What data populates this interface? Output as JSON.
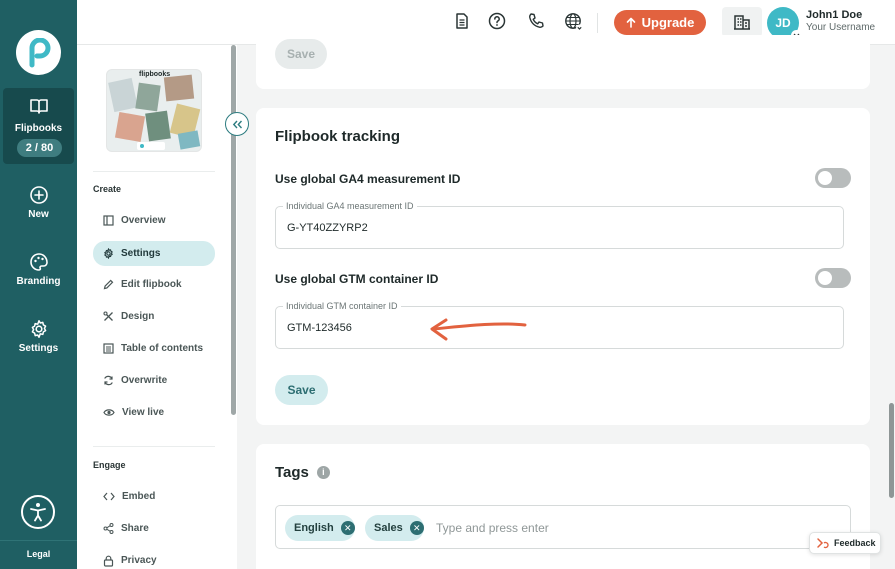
{
  "rail": {
    "flipbooks_label": "Flipbooks",
    "flipbooks_count": "2 / 80",
    "new_label": "New",
    "branding_label": "Branding",
    "settings_label": "Settings",
    "legal_label": "Legal"
  },
  "topbar": {
    "upgrade_label": "Upgrade",
    "avatar_initials": "JD",
    "user_name": "John1 Doe",
    "user_sub": "Your Username"
  },
  "sidebar": {
    "thumbnail_brand": "flipbooks",
    "create_title": "Create",
    "create_items": [
      {
        "label": "Overview",
        "icon": "overview-icon"
      },
      {
        "label": "Settings",
        "icon": "gear-icon"
      },
      {
        "label": "Edit flipbook",
        "icon": "pencil-icon"
      },
      {
        "label": "Design",
        "icon": "design-tools-icon"
      },
      {
        "label": "Table of contents",
        "icon": "list-icon"
      },
      {
        "label": "Overwrite",
        "icon": "refresh-icon"
      },
      {
        "label": "View live",
        "icon": "eye-icon"
      }
    ],
    "engage_title": "Engage",
    "engage_items": [
      {
        "label": "Embed",
        "icon": "code-icon"
      },
      {
        "label": "Share",
        "icon": "share-icon"
      },
      {
        "label": "Privacy",
        "icon": "lock-icon"
      }
    ]
  },
  "top_card": {
    "save_label": "Save"
  },
  "tracking": {
    "title": "Flipbook tracking",
    "ga4_toggle_label": "Use global GA4 measurement ID",
    "ga4_field_label": "Individual GA4 measurement ID",
    "ga4_field_value": "G-YT40ZZYRP2",
    "gtm_toggle_label": "Use global GTM container ID",
    "gtm_field_label": "Individual GTM container ID",
    "gtm_field_value": "GTM-123456",
    "save_label": "Save"
  },
  "tags": {
    "title": "Tags",
    "info_glyph": "i",
    "chips": [
      "English",
      "Sales"
    ],
    "placeholder": "Type and press enter"
  },
  "feedback_label": "Feedback",
  "colors": {
    "rail": "#1f5f63",
    "accent": "#3fb9c6",
    "upgrade": "#e2623f",
    "arrow": "#e2623f",
    "chip": "#d3ecee"
  }
}
